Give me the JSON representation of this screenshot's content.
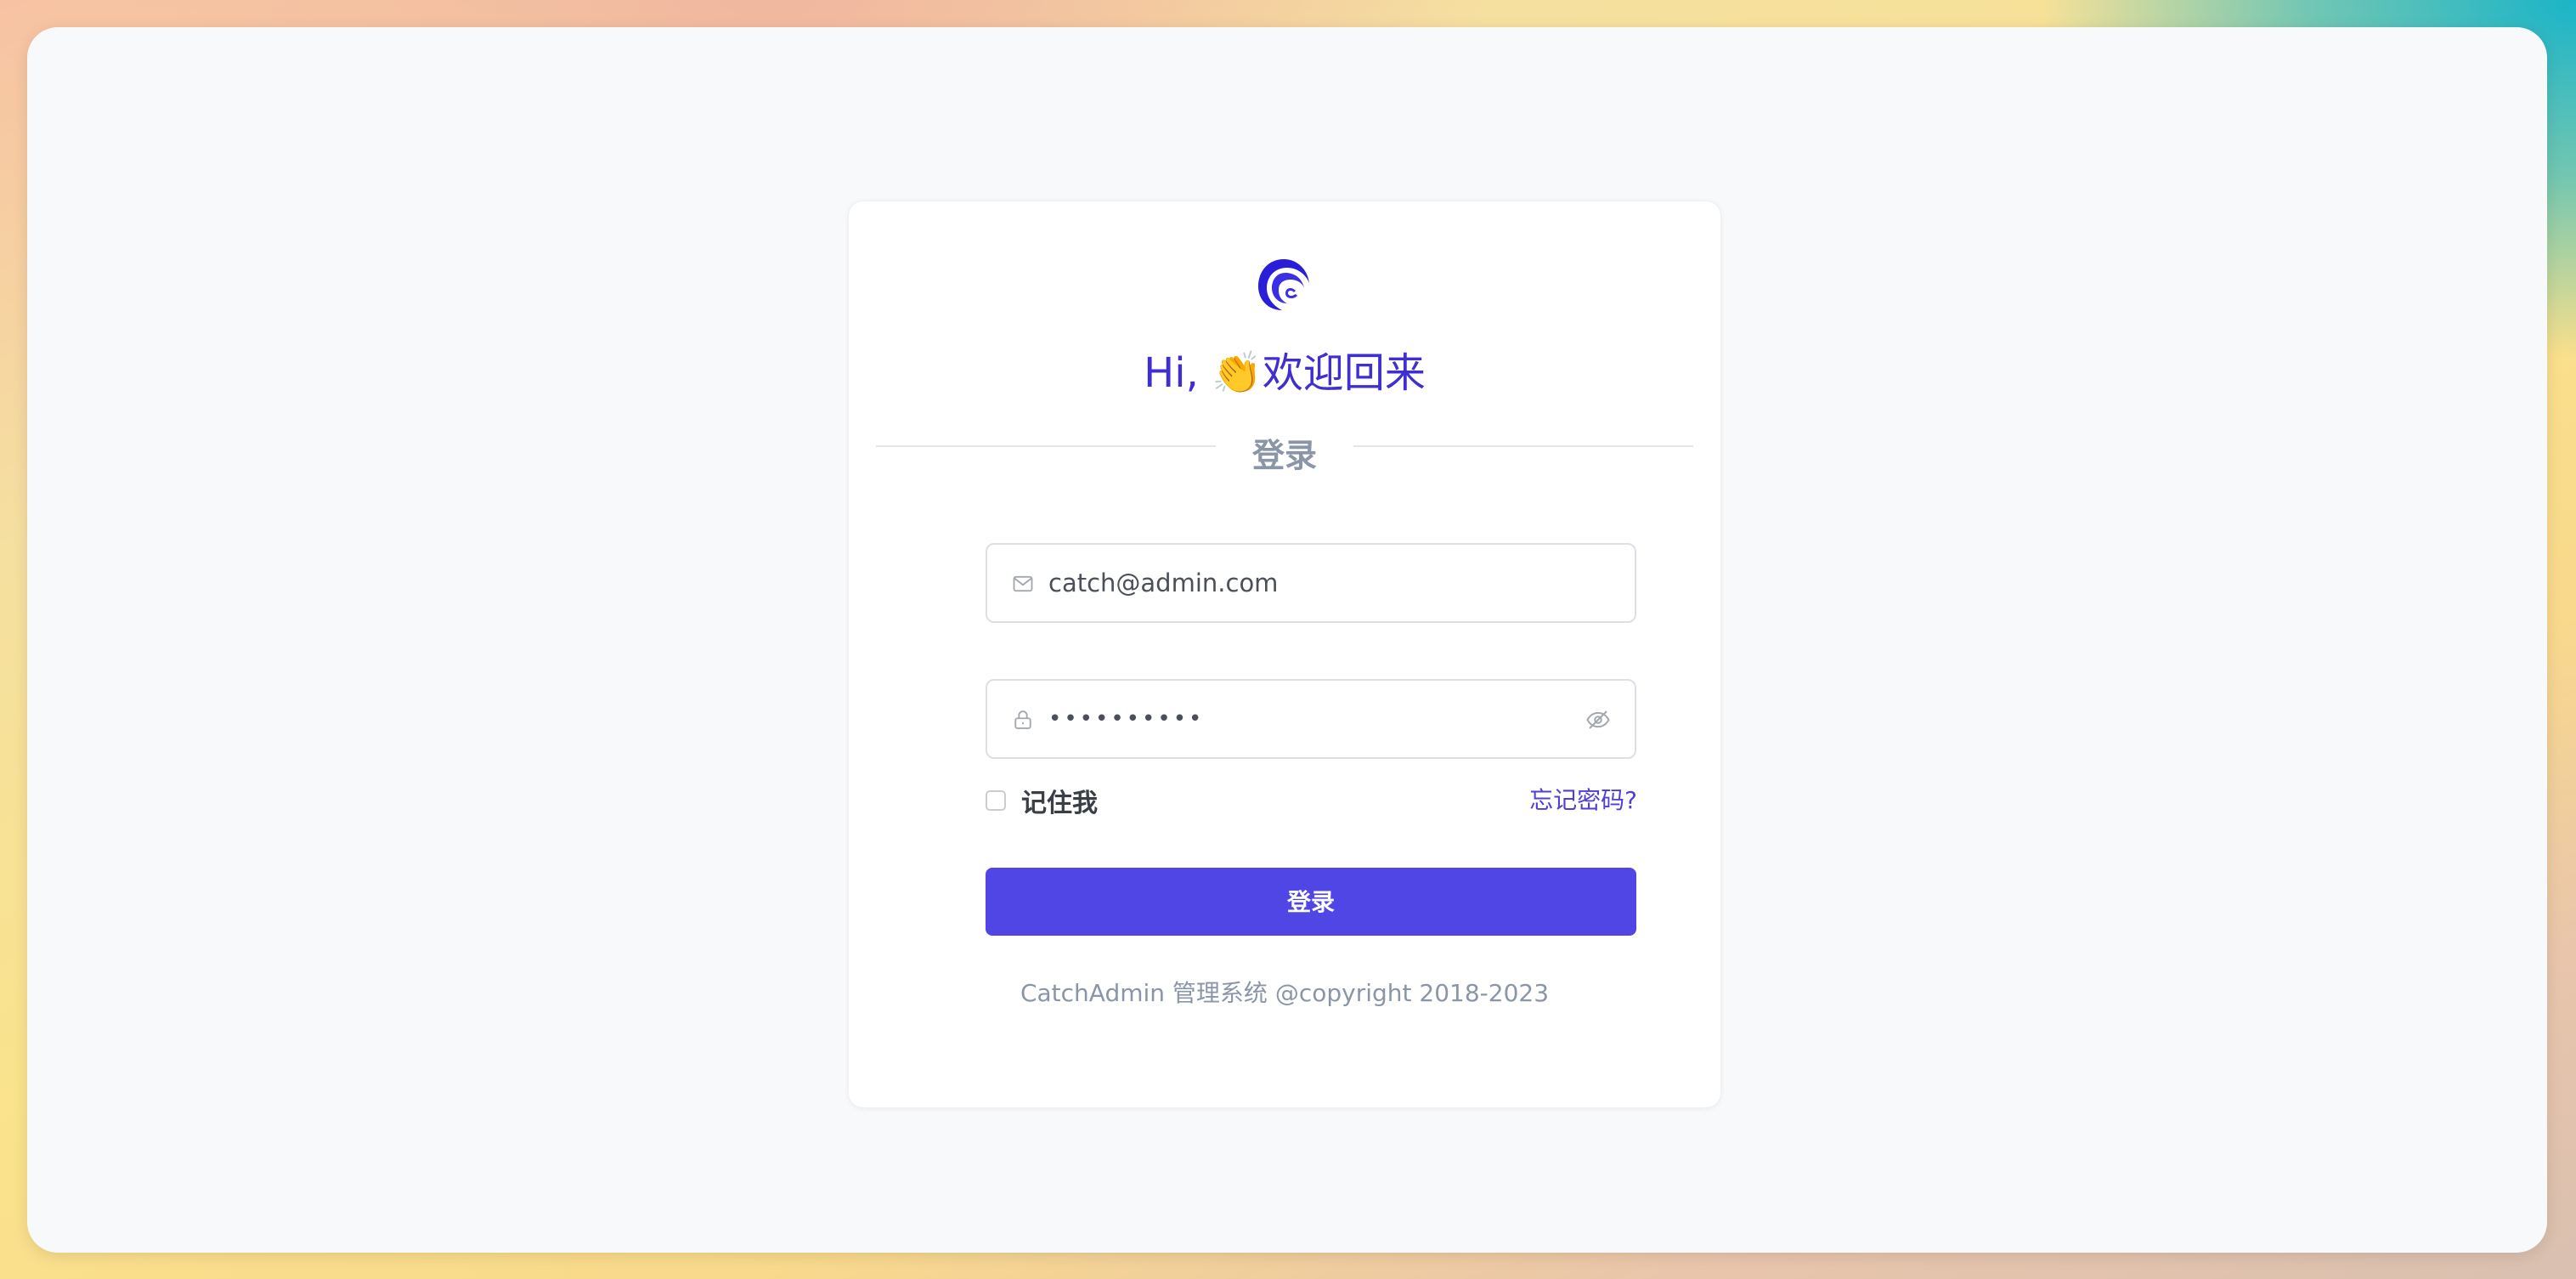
{
  "login": {
    "greeting": "Hi, 👏欢迎回来",
    "section_title": "登录",
    "email_value": "catch@admin.com",
    "password_masked": "••••••••••",
    "remember_label": "记住我",
    "forgot_label": "忘记密码?",
    "submit_label": "登录",
    "copyright": "CatchAdmin 管理系统 @copyright 2018-2023"
  },
  "icons": {
    "logo": "catchadmin-logo",
    "email": "mail-icon",
    "password": "lock-icon",
    "toggle": "eye-off-icon"
  },
  "colors": {
    "brand": "#4f46e5",
    "greeting": "#3f2fd1",
    "muted": "#8a96a8"
  }
}
